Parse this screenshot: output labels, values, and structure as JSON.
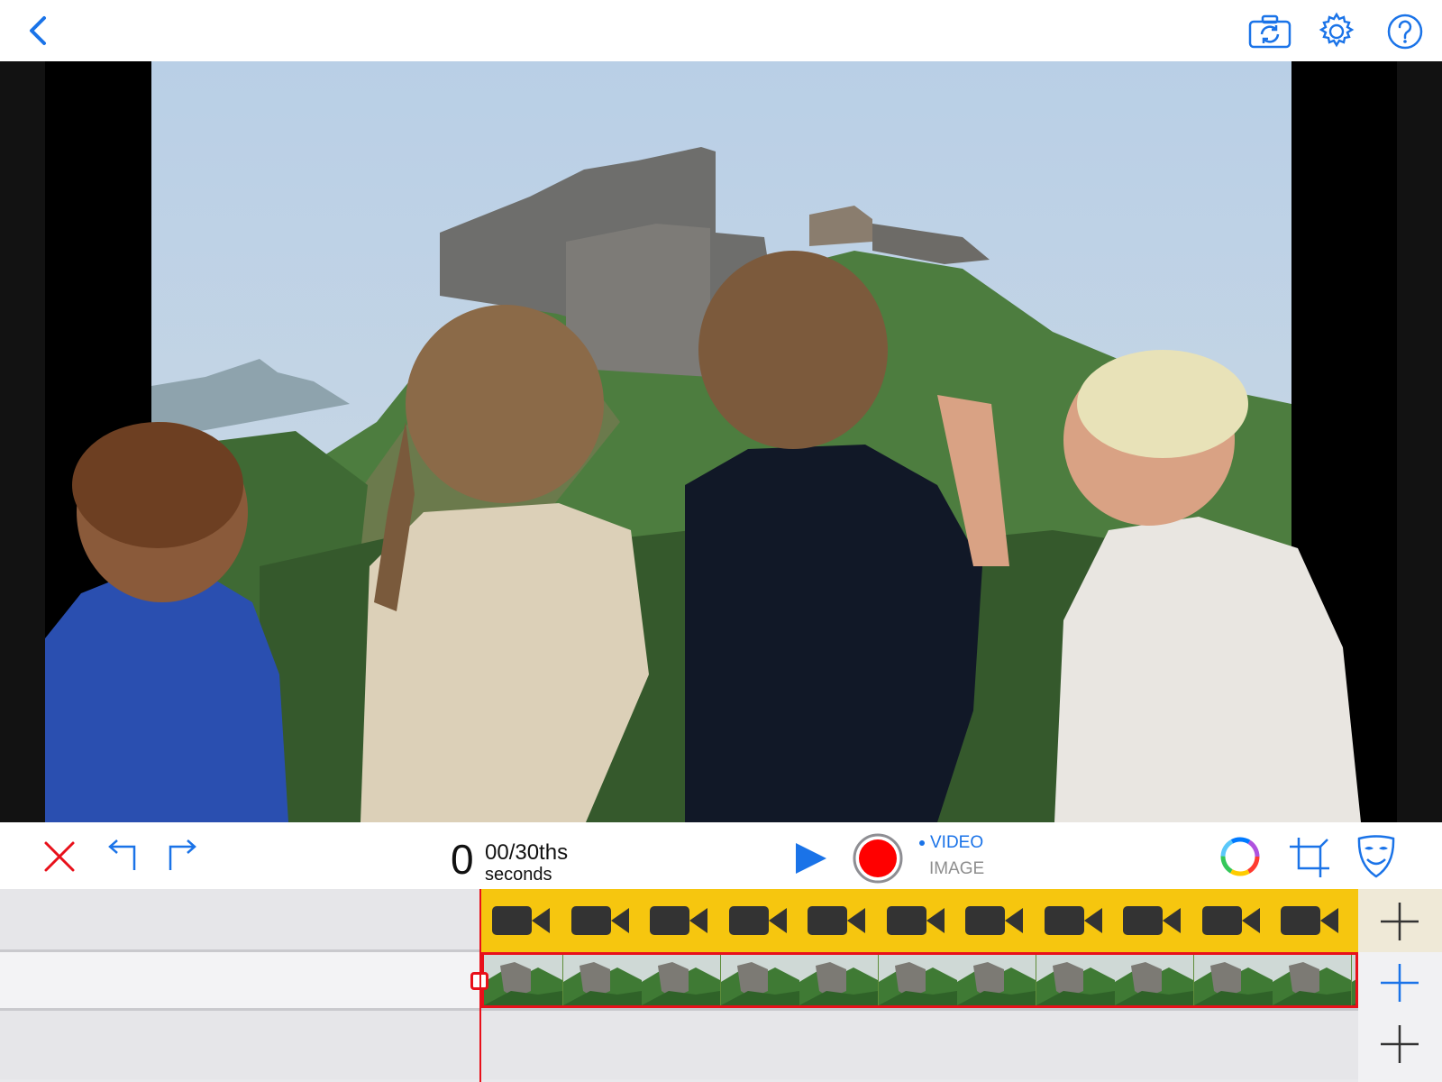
{
  "topbar": {
    "back_icon": "chevron-left-icon",
    "camera_switch_icon": "camera-switch-icon",
    "settings_icon": "gear-icon",
    "help_icon": "help-icon"
  },
  "preview": {
    "content": "photo"
  },
  "controls": {
    "delete_icon": "close-icon",
    "undo_icon": "undo-icon",
    "redo_icon": "redo-icon",
    "time_seconds": "0",
    "time_fraction": "00/30ths",
    "time_unit": "seconds",
    "play_icon": "play-icon",
    "record_icon": "record-icon",
    "mode_video": "VIDEO",
    "mode_image": "IMAGE",
    "active_mode": "VIDEO",
    "color_icon": "color-wheel-icon",
    "crop_icon": "crop-icon",
    "mask_icon": "mask-icon"
  },
  "timeline": {
    "tracks": [
      {
        "type": "video",
        "clip_color": "#f6c60f"
      },
      {
        "type": "image",
        "clip_border": "#e8101a"
      },
      {
        "type": "empty"
      }
    ],
    "add_icons": [
      "plus-icon",
      "plus-icon",
      "plus-icon"
    ]
  },
  "colors": {
    "accent": "#1a73e8",
    "record": "#ff0000",
    "delete": "#e8101a",
    "video_clip": "#f6c60f"
  }
}
